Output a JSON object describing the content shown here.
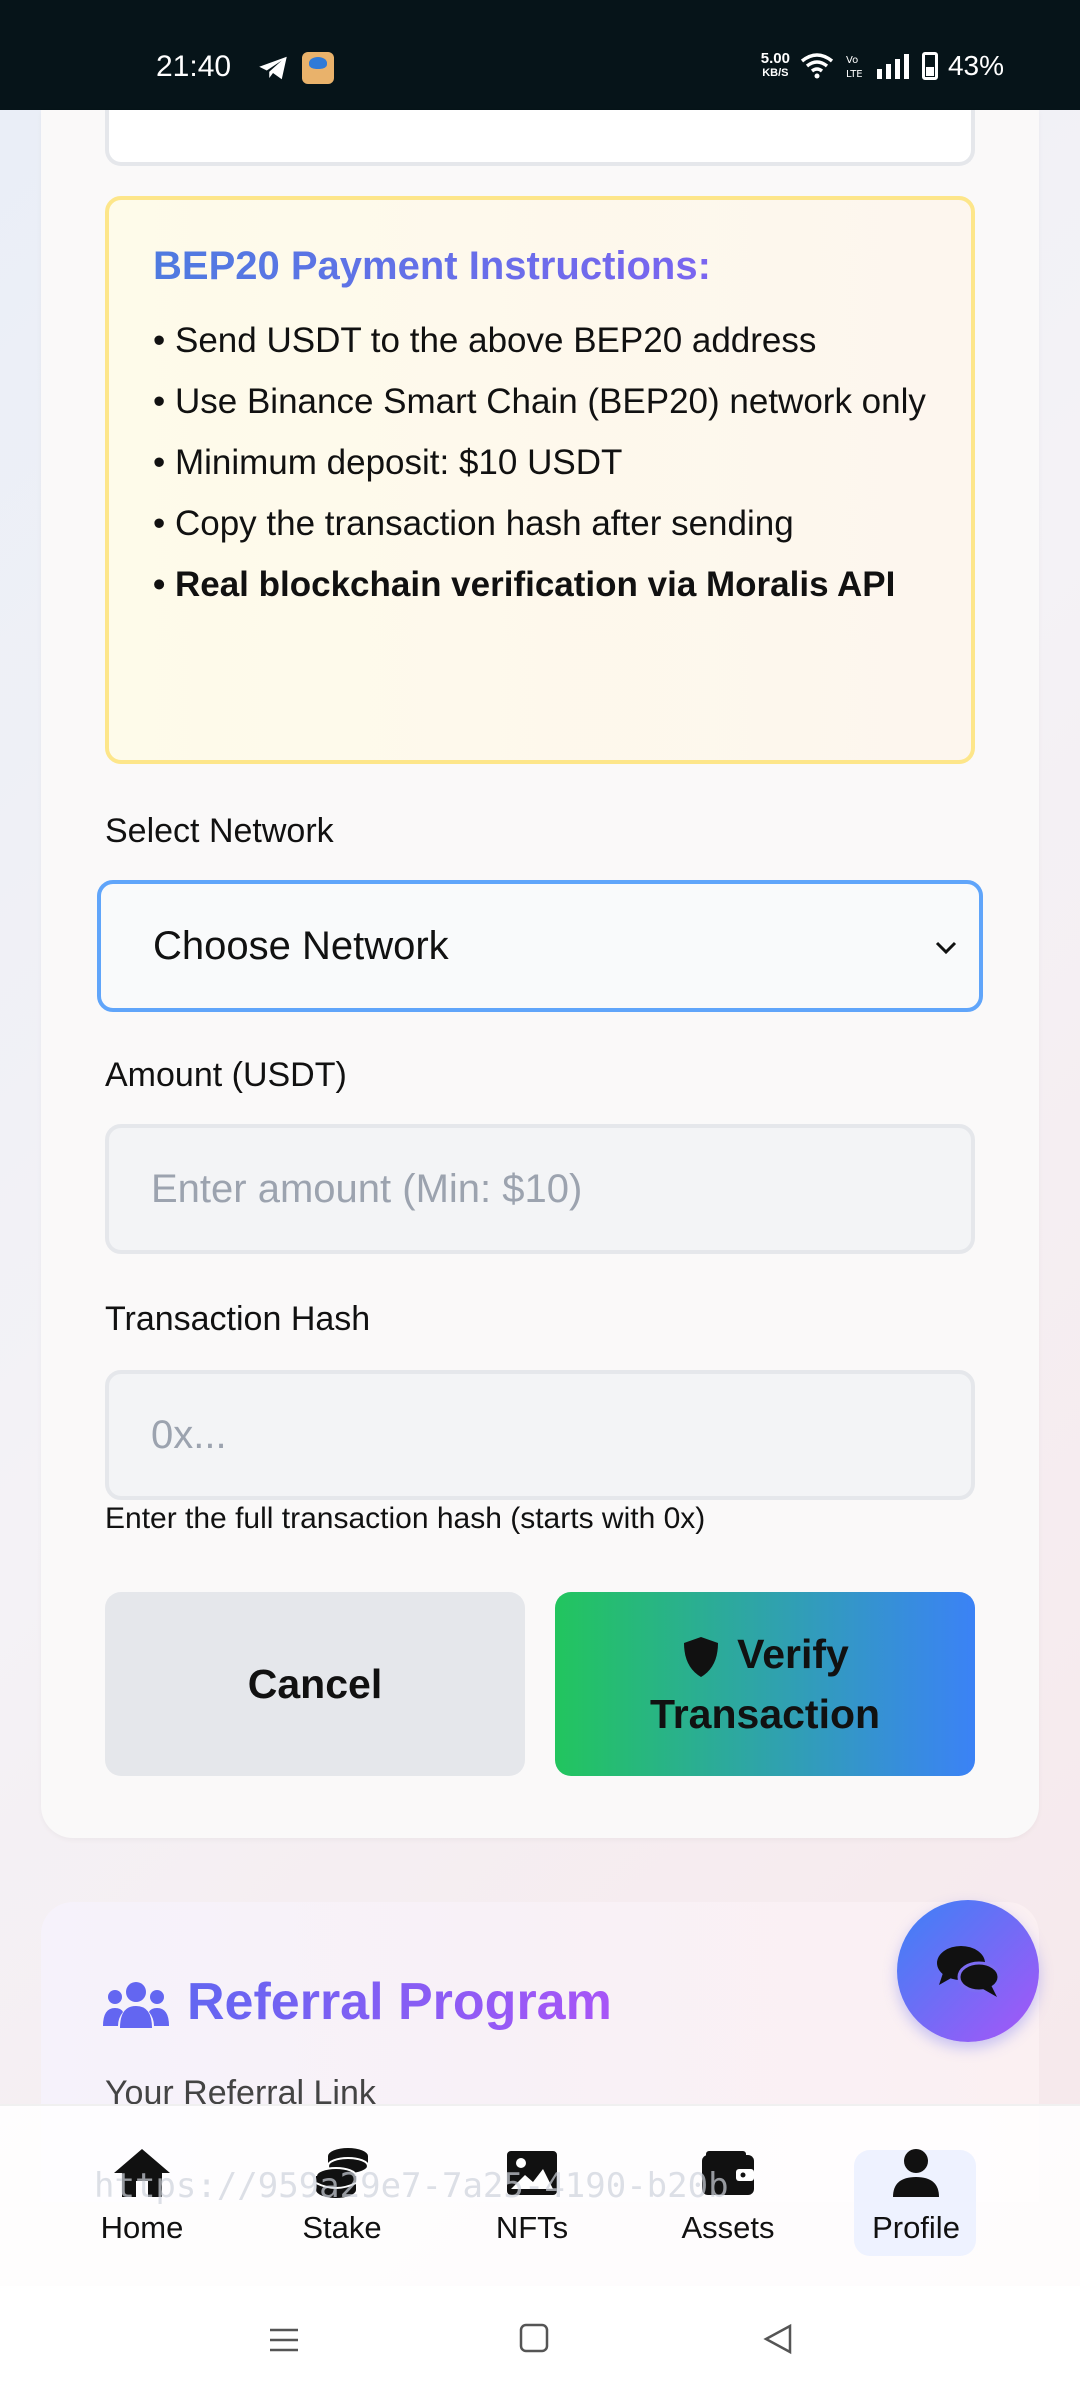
{
  "status_bar": {
    "time": "21:40",
    "speed_value": "5.00",
    "speed_unit": "KB/S",
    "battery": "43%",
    "icons": [
      "telegram-icon",
      "app-icon",
      "wifi-icon",
      "volte-icon",
      "signal-icon",
      "battery-icon"
    ]
  },
  "instructions": {
    "title": "BEP20 Payment Instructions:",
    "items": [
      "• Send USDT to the above BEP20 address",
      "• Use Binance Smart Chain (BEP20) network only",
      "• Minimum deposit: $10 USDT",
      "• Copy the transaction hash after sending",
      "• Real blockchain verification via Moralis API"
    ]
  },
  "network": {
    "label": "Select Network",
    "selected": "Choose Network"
  },
  "amount": {
    "label": "Amount (USDT)",
    "value": "",
    "placeholder": "Enter amount (Min: $10)"
  },
  "tx_hash": {
    "label": "Transaction Hash",
    "value": "",
    "placeholder": "0x...",
    "hint": "Enter the full transaction hash (starts with 0x)"
  },
  "buttons": {
    "cancel": "Cancel",
    "verify_line1": "Verify",
    "verify_line2": "Transaction"
  },
  "referral": {
    "title": "Referral Program",
    "link_label": "Your Referral Link",
    "link": "https://959a29e7-7a25-4190-b20b"
  },
  "bottom_nav": {
    "items": [
      {
        "label": "Home",
        "icon": "home-icon"
      },
      {
        "label": "Stake",
        "icon": "coins-icon"
      },
      {
        "label": "NFTs",
        "icon": "image-icon"
      },
      {
        "label": "Assets",
        "icon": "wallet-icon"
      },
      {
        "label": "Profile",
        "icon": "user-icon"
      }
    ],
    "active": "Profile"
  },
  "colors": {
    "accent_blue": "#60a5fa",
    "verify_gradient_start": "#22c55e",
    "verify_gradient_end": "#3b82f6",
    "instructions_border": "#fde68a",
    "title_gradient_start": "#4f7be0",
    "title_gradient_end": "#8b5cf6"
  }
}
